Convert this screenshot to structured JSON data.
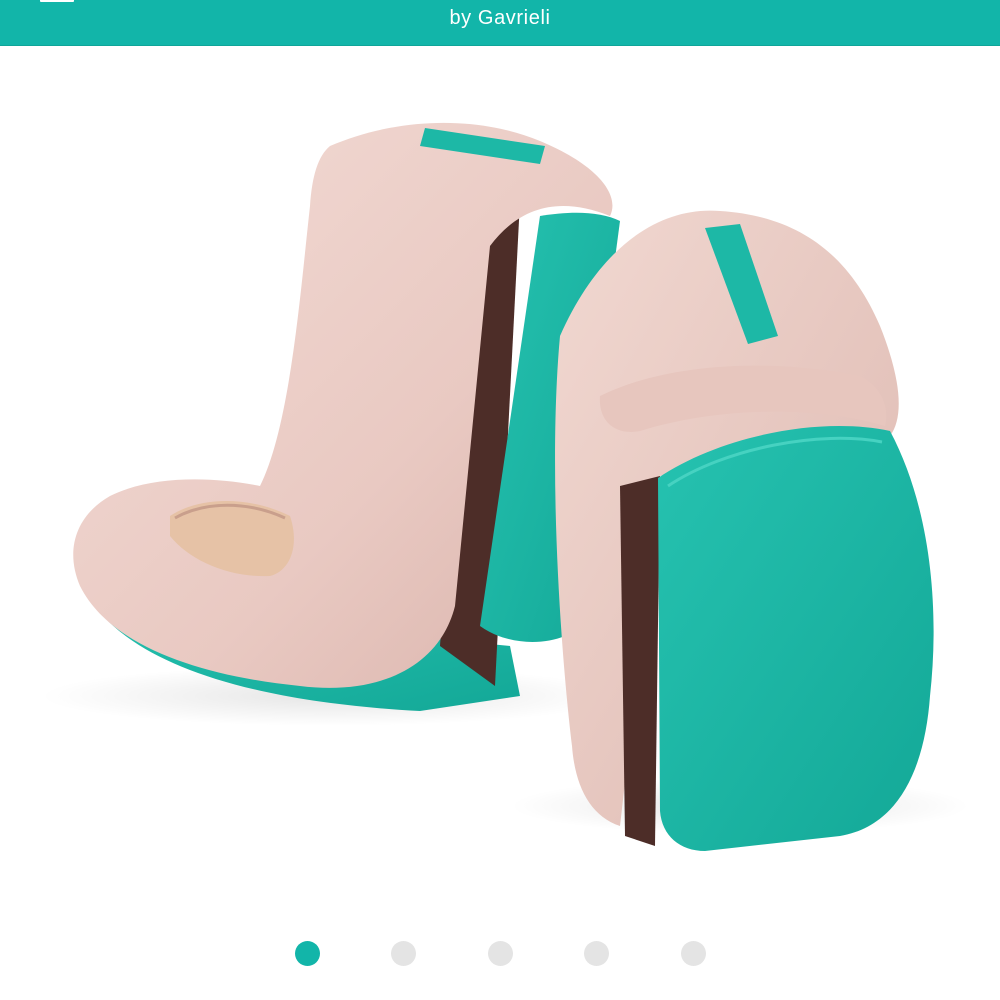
{
  "header": {
    "subtitle": "by Gavrieli",
    "background_color": "#12b5a9",
    "menu_icon": "hamburger-menu-icon",
    "cart_icon": "shopping-bag-icon"
  },
  "product": {
    "image_icon": "ballet-flats-product-photo",
    "colors": {
      "leather": "#edcfc9",
      "sole": "#1db8a6",
      "lining": "#4d2d28"
    }
  },
  "carousel": {
    "slide_count": 5,
    "active_index": 0,
    "active_color": "#12b5a9",
    "inactive_color": "#e4e4e4"
  }
}
